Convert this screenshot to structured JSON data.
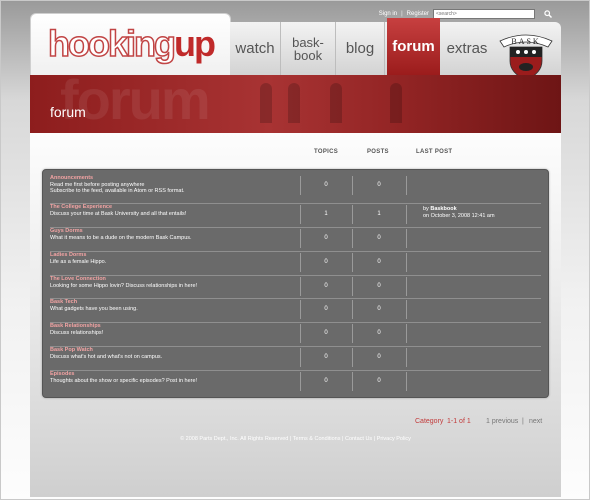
{
  "util": {
    "signin": "Sign in",
    "sep": "|",
    "register": "Register",
    "search_placeholder": "<search>",
    "search_icon": "magnifier-icon"
  },
  "logo": {
    "part1": "hooking",
    "part2": "up"
  },
  "nav": {
    "watch": "watch",
    "baskbook_line1": "bask-",
    "baskbook_line2": "book",
    "blog": "blog",
    "forum": "forum",
    "extras": "extras"
  },
  "crest": {
    "text": "BASK"
  },
  "banner": {
    "title": "forum",
    "ghost": "forum"
  },
  "columns": {
    "topics": "TOPICS",
    "posts": "POSTS",
    "last": "LAST POST"
  },
  "forums": [
    {
      "name": "Announcements",
      "desc": [
        "Read me first before posting anywhere",
        "Subscribe to the feed, available in Atom or RSS format."
      ],
      "topics": "0",
      "posts": "0",
      "last_by": "",
      "last_user": "",
      "last_date": ""
    },
    {
      "name": "The College Experience",
      "desc": [
        "Discuss your time at Bask University and all that entails!"
      ],
      "topics": "1",
      "posts": "1",
      "last_by": "by",
      "last_user": "Baskbook",
      "last_date": "on October 3, 2008 12:41 am"
    },
    {
      "name": "Guys Dorms",
      "desc": [
        "What it means to be a dude on the modern Bask Campus."
      ],
      "topics": "0",
      "posts": "0",
      "last_by": "",
      "last_user": "",
      "last_date": ""
    },
    {
      "name": "Ladies Dorms",
      "desc": [
        "Life as a female Hippo."
      ],
      "topics": "0",
      "posts": "0",
      "last_by": "",
      "last_user": "",
      "last_date": ""
    },
    {
      "name": "The Love Connection",
      "desc": [
        "Looking for some Hippo lovin? Discuss relationships in here!"
      ],
      "topics": "0",
      "posts": "0",
      "last_by": "",
      "last_user": "",
      "last_date": ""
    },
    {
      "name": "Bask Tech",
      "desc": [
        "What gadgets have you been using."
      ],
      "topics": "0",
      "posts": "0",
      "last_by": "",
      "last_user": "",
      "last_date": ""
    },
    {
      "name": "Bask Relationships",
      "desc": [
        "Discuss relationships!"
      ],
      "topics": "0",
      "posts": "0",
      "last_by": "",
      "last_user": "",
      "last_date": ""
    },
    {
      "name": "Bask Pop Watch",
      "desc": [
        "Discuss what's hot and what's not on campus."
      ],
      "topics": "0",
      "posts": "0",
      "last_by": "",
      "last_user": "",
      "last_date": ""
    },
    {
      "name": "Episodes",
      "desc": [
        "Thoughts about the show or specific episodes? Post in here!"
      ],
      "topics": "0",
      "posts": "0",
      "last_by": "",
      "last_user": "",
      "last_date": ""
    }
  ],
  "pager": {
    "category": "Category",
    "range": "1-1 of 1",
    "previous": "1 previous",
    "sep": "|",
    "next": "next"
  },
  "footer": {
    "copyright": "© 2008 Parts Dept., Inc. All Rights Reserved",
    "terms": "Terms & Conditions",
    "contact": "Contact Us",
    "privacy": "Privacy Policy",
    "sep": "|"
  }
}
